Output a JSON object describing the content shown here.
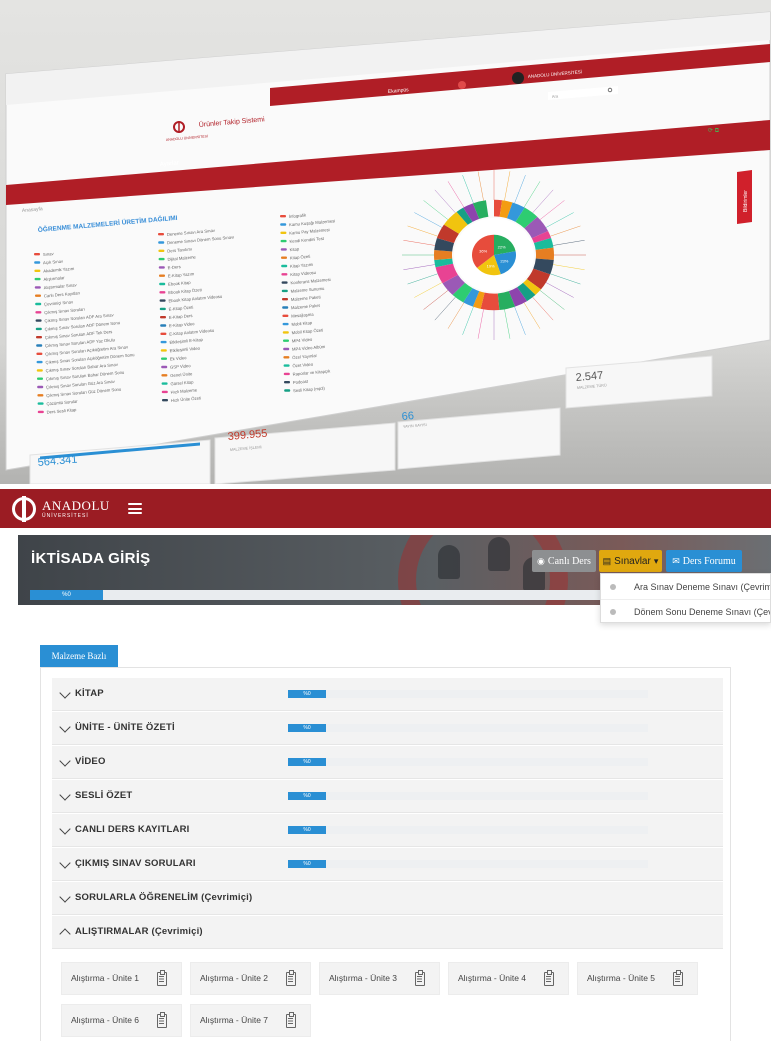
{
  "dashboard": {
    "app_title": "Ürünler Takip Sistemi",
    "university": "ANADOLU ÜNİVERSİTESİ",
    "settings_label": "Ayarlar",
    "menu_item": "Ekampüs",
    "user_name": "ANADOLU ÜNİVERSİTESİ",
    "search_placeholder": "Ara",
    "breadcrumb": "Anasayfa",
    "side_tab": "Bildirimler",
    "section_title": "ÖĞRENME MALZEMELERİ ÜRETİM DAĞILIMI",
    "legend_col1": [
      "Sınav",
      "Açık Sınav",
      "Akademik Yazım",
      "Alıştırmalar",
      "Alıştırmalar Sınav",
      "Canlı Ders Kayıtları",
      "Çevrimiçi Sınav",
      "Çıkmış Sınav Soruları",
      "Çıkmış Sınav Soruları ADF Ara Sınav",
      "Çıkmış Sınav Soruları ADF Dönem Sonu",
      "Çıkmış Sınav Soruları ADF Tek Ders",
      "Çıkmış Sınav Soruları ADF Yaz Okulu",
      "Çıkmış Sınav Soruları Açıköğretim Ara Sınav",
      "Çıkmış Sınav Soruları Açıköğretim Dönem Sonu",
      "Çıkmış Sınav Soruları Bahar Ara Sınav",
      "Çıkmış Sınav Soruları Bahar Dönem Sonu",
      "Çıkmış Sınav Soruları Güz Ara Sınav",
      "Çıkmış Sınav Soruları Güz Dönem Sonu",
      "Çözümlü Sorular",
      "Ders Sesli Kitap"
    ],
    "legend_col2": [
      "Deneme Sınavı Ara Sınav",
      "Deneme Sınavı Dönem Sonu Sınavı",
      "Ders Tanıtımı",
      "Dijital Malzeme",
      "E-Ders",
      "E-Kitap Yazım",
      "Ebook Kitap",
      "Ebook Kitap Özeti",
      "Ebook Kitap Anlatım Videosu",
      "E-Kitap Özeti",
      "E-Kitap Ders",
      "E-Kitap Video",
      "E-Kitap Anlatım Videosu",
      "Etkileşimli E-Kitap",
      "Etkileşimli Video",
      "Ek Video",
      "GSP Video",
      "Genel Ünite",
      "Görsel Kitap",
      "Hızlı Malzeme",
      "Hızlı Ünite Özeti"
    ],
    "legend_col3": [
      "İnfografik",
      "Kamu Kuşağı Malzemesi",
      "Kamu Pay Malzemesi",
      "Kendi Kendini Test",
      "Kitap",
      "Kitap Özeti",
      "Kitap Yazımı",
      "Kitap Videosu",
      "Konferans Malzemesi",
      "Malzeme Sunumu",
      "Malzeme Paketi",
      "Malzeme Paket",
      "Mesajlaşma",
      "Mobil Kitap",
      "Mobil Kitap Özeti",
      "MP4 Video",
      "MP4 Video Albüm",
      "Özel Yayınlar",
      "Özet Video",
      "Raporlar ve Kitapçık",
      "Podcast",
      "Sesli Kitap (mp3)"
    ],
    "stats": [
      {
        "value": "564.341",
        "label": "MALZEME İŞLEMİ"
      },
      {
        "value": "399.955",
        "label": "MALZEME İŞLEMİ"
      },
      {
        "value": "66",
        "label": "YAYIN SAYISI"
      },
      {
        "value": "2.547",
        "label": "MALZEME TÜRÜ"
      }
    ],
    "donut_center": [
      "22%",
      "23%",
      "19%",
      "36%"
    ]
  },
  "navbar": {
    "brand_name": "ANADOLU",
    "brand_sub": "ÜNİVERSİTESİ"
  },
  "course": {
    "title": "İKTİSADA GİRİŞ",
    "progress_label": "%0",
    "progress_value": 0
  },
  "buttons": {
    "canli_ders": "Canlı Ders",
    "sinavlar": "Sınavlar",
    "ders_forumu": "Ders Forumu"
  },
  "exam_dropdown": [
    "Ara Sınav Deneme Sınavı (Çevrimiçi)",
    "Dönem Sonu Deneme Sınavı (Çevrimiçi)"
  ],
  "materials": {
    "tab_label": "Malzeme Bazlı",
    "rows": [
      {
        "label": "KİTAP",
        "progress": "%0",
        "progress_value": 0
      },
      {
        "label": "ÜNİTE - ÜNİTE ÖZETİ",
        "progress": "%0",
        "progress_value": 0
      },
      {
        "label": "VİDEO",
        "progress": "%0",
        "progress_value": 0
      },
      {
        "label": "SESLİ ÖZET",
        "progress": "%0",
        "progress_value": 0
      },
      {
        "label": "CANLI DERS KAYITLARI",
        "progress": "%0",
        "progress_value": 0
      },
      {
        "label": "ÇIKMIŞ SINAV SORULARI",
        "progress": "%0",
        "progress_value": 0
      },
      {
        "label": "SORULARLA ÖĞRENELİM (Çevrimiçi)"
      },
      {
        "label": "ALIŞTIRMALAR (Çevrimiçi)"
      }
    ],
    "exercises": [
      "Alıştırma - Ünite 1",
      "Alıştırma - Ünite 2",
      "Alıştırma - Ünite 3",
      "Alıştırma - Ünite 4",
      "Alıştırma - Ünite 5",
      "Alıştırma - Ünite 6",
      "Alıştırma - Ünite 7"
    ]
  },
  "colors": {
    "brand_red": "#9b1c23",
    "accent_blue": "#2a8fd4",
    "warning_yellow": "#e0a80f"
  }
}
